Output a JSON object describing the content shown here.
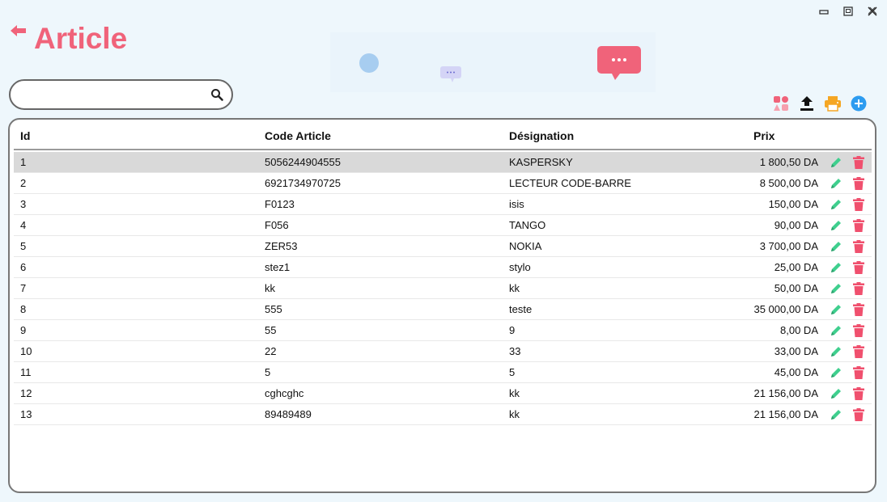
{
  "header": {
    "title": "Article"
  },
  "search": {
    "value": "",
    "placeholder": ""
  },
  "colors": {
    "accent": "#f0637a",
    "edit": "#3fcf8e",
    "delete": "#f0506e",
    "print": "#f5a623",
    "add": "#2d9cf0"
  },
  "table": {
    "columns": {
      "id": "Id",
      "code": "Code Article",
      "designation": "Désignation",
      "prix": "Prix"
    },
    "rows": [
      {
        "id": "1",
        "code": "5056244904555",
        "designation": "KASPERSKY",
        "prix": "1 800,50 DA"
      },
      {
        "id": "2",
        "code": "6921734970725",
        "designation": "LECTEUR CODE-BARRE",
        "prix": "8 500,00 DA"
      },
      {
        "id": "3",
        "code": "F0123",
        "designation": "isis",
        "prix": "150,00 DA"
      },
      {
        "id": "4",
        "code": "F056",
        "designation": "TANGO",
        "prix": "90,00 DA"
      },
      {
        "id": "5",
        "code": "ZER53",
        "designation": "NOKIA",
        "prix": "3 700,00 DA"
      },
      {
        "id": "6",
        "code": "stez1",
        "designation": "stylo",
        "prix": "25,00 DA"
      },
      {
        "id": "7",
        "code": "kk",
        "designation": "kk",
        "prix": "50,00 DA"
      },
      {
        "id": "8",
        "code": "555",
        "designation": "teste",
        "prix": "35 000,00 DA"
      },
      {
        "id": "9",
        "code": "55",
        "designation": "9",
        "prix": "8,00 DA"
      },
      {
        "id": "10",
        "code": "22",
        "designation": "33",
        "prix": "33,00 DA"
      },
      {
        "id": "11",
        "code": "5",
        "designation": "5",
        "prix": "45,00 DA"
      },
      {
        "id": "12",
        "code": "cghcghc",
        "designation": "kk",
        "prix": "21 156,00 DA"
      },
      {
        "id": "13",
        "code": "89489489",
        "designation": "kk",
        "prix": "21 156,00 DA"
      }
    ]
  }
}
